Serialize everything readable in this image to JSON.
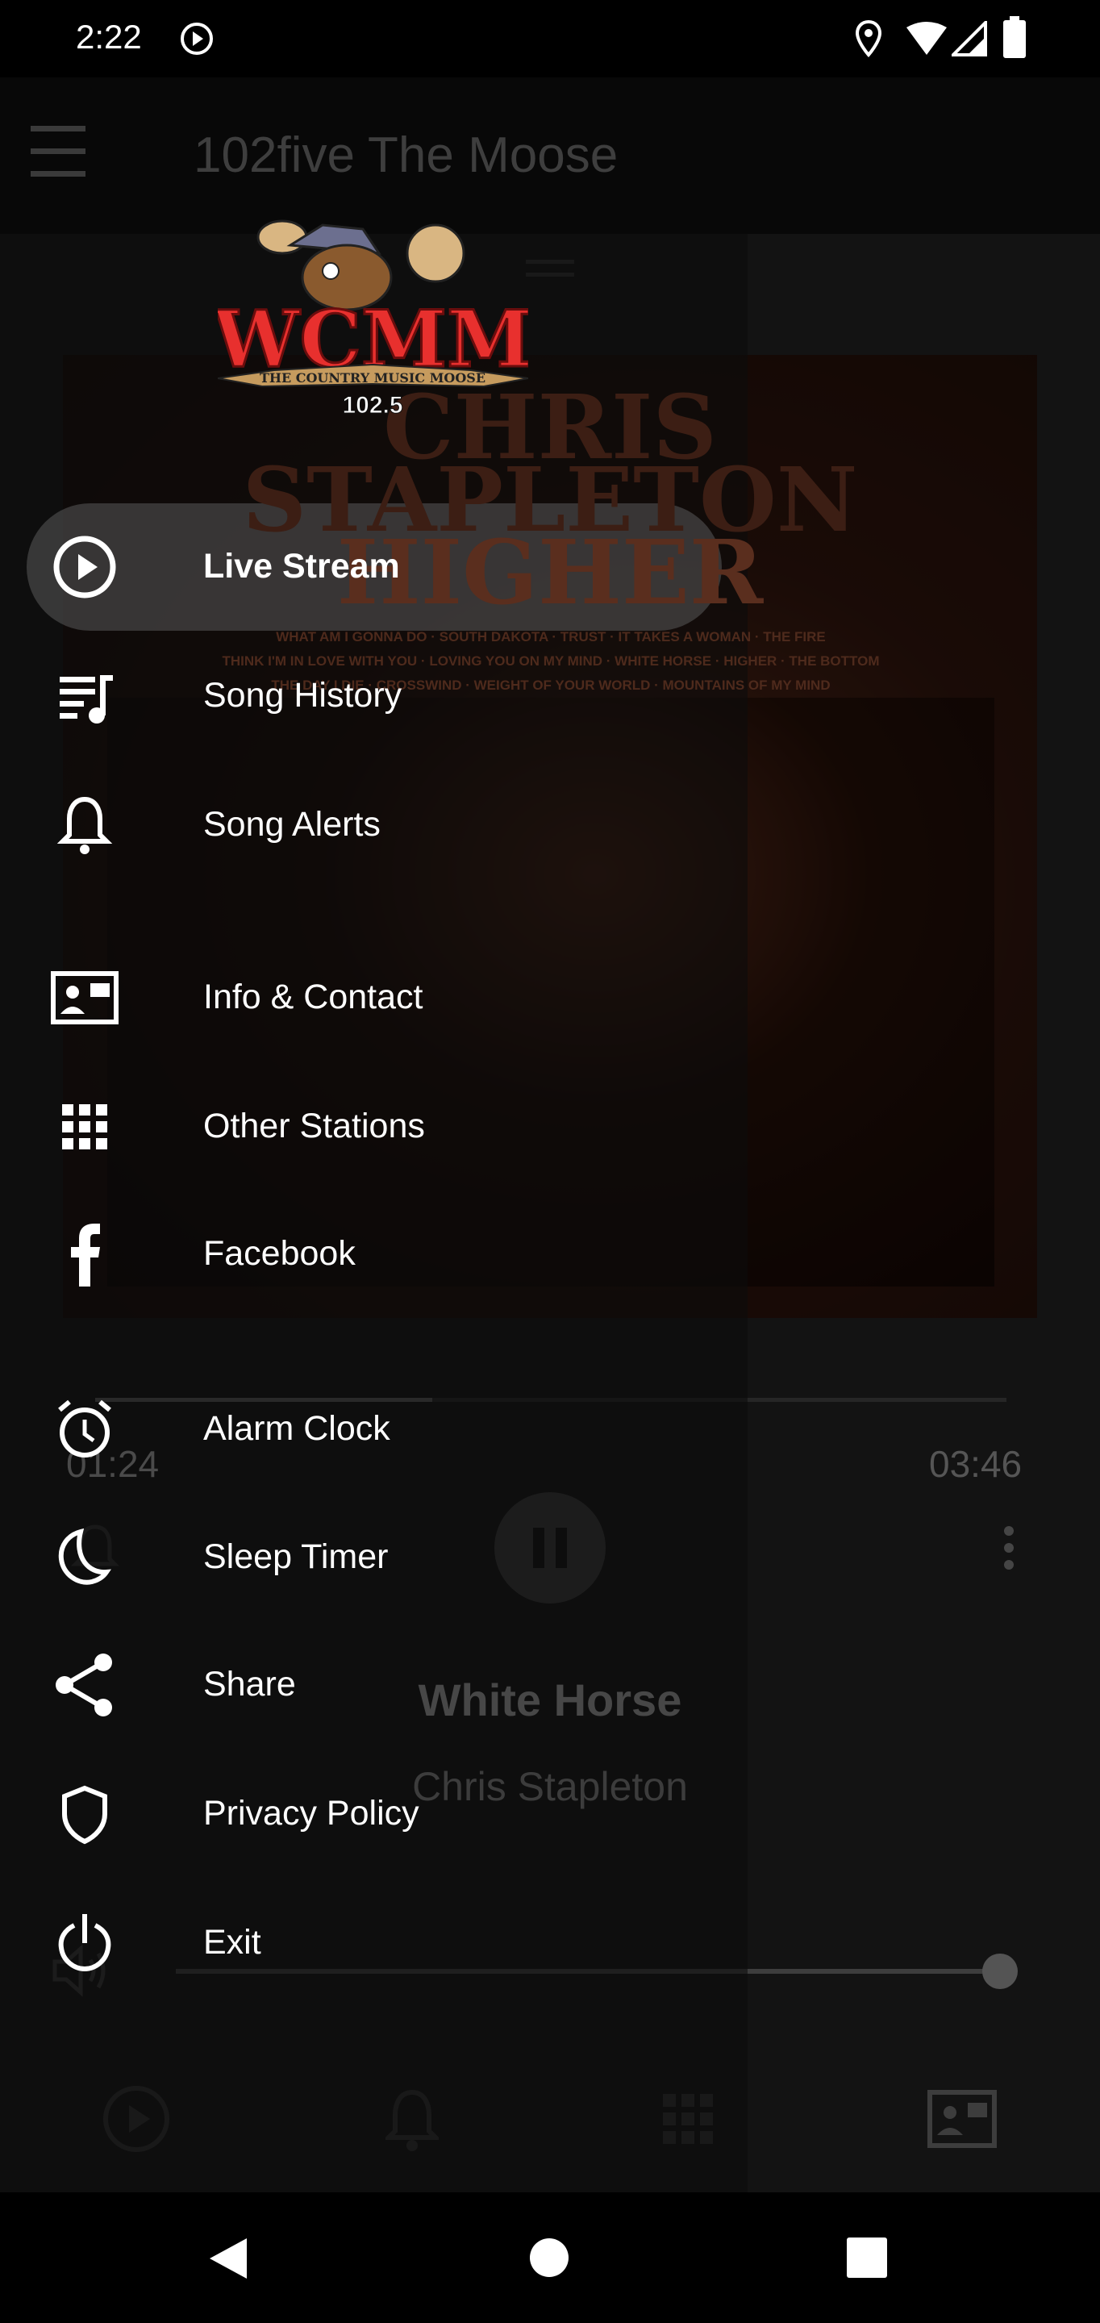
{
  "status_bar": {
    "time": "2:22",
    "icons": [
      "play-notification-icon",
      "location-icon",
      "wifi-icon",
      "signal-icon",
      "battery-icon"
    ]
  },
  "toolbar": {
    "title": "102five The Moose",
    "menu_icon": "hamburger-icon"
  },
  "logo": {
    "call_letters": "WCMM",
    "tagline": "THE COUNTRY MUSIC MOOSE",
    "frequency": "102.5"
  },
  "album": {
    "line1": "CHRIS",
    "line2": "STAPLETON",
    "line3": "HIGHER",
    "tracks": [
      "WHAT AM I GONNA DO · SOUTH DAKOTA · TRUST · IT TAKES A WOMAN · THE FIRE",
      "THINK I'M IN LOVE WITH YOU · LOVING YOU ON MY MIND · WHITE HORSE · HIGHER · THE BOTTOM",
      "THE DAY I DIE · CROSSWIND · WEIGHT OF YOUR WORLD · MOUNTAINS OF MY MIND"
    ]
  },
  "player": {
    "elapsed": "01:24",
    "duration": "03:46",
    "progress_percent": 37,
    "song": "White Horse",
    "artist": "Chris Stapleton",
    "volume_percent": 100
  },
  "drawer": {
    "items": [
      {
        "label": "Live Stream",
        "icon": "play-circle-icon",
        "active": true
      },
      {
        "label": "Song History",
        "icon": "playlist-icon"
      },
      {
        "label": "Song Alerts",
        "icon": "bell-icon"
      },
      {
        "label": "Info & Contact",
        "icon": "contact-card-icon"
      },
      {
        "label": "Other Stations",
        "icon": "grid-icon"
      },
      {
        "label": "Facebook",
        "icon": "facebook-icon"
      },
      {
        "label": "Alarm Clock",
        "icon": "alarm-icon"
      },
      {
        "label": "Sleep Timer",
        "icon": "moon-icon"
      },
      {
        "label": "Share",
        "icon": "share-icon"
      },
      {
        "label": "Privacy Policy",
        "icon": "shield-icon"
      },
      {
        "label": "Exit",
        "icon": "power-icon"
      }
    ]
  },
  "bottom_nav": [
    "play-circle-icon",
    "bell-icon",
    "grid-icon",
    "contact-card-icon"
  ]
}
